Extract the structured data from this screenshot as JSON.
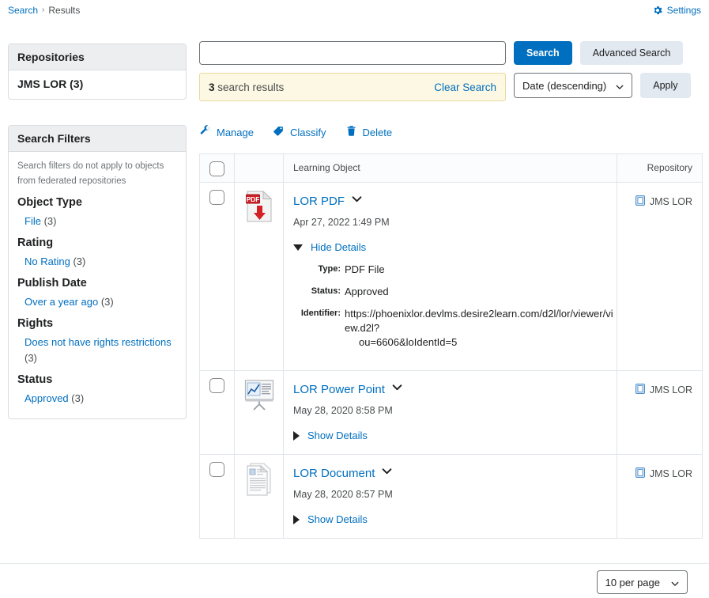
{
  "breadcrumb": {
    "root": "Search",
    "separator": "›",
    "current": "Results"
  },
  "settings": {
    "label": "Settings",
    "icon": "gear-icon",
    "color": "#006fbf"
  },
  "sidebar": {
    "repositories": {
      "title": "Repositories",
      "items": [
        {
          "label": "JMS LOR (3)"
        }
      ]
    },
    "search_filters": {
      "title": "Search Filters",
      "note": "Search filters do not apply to objects from federated repositories",
      "groups": [
        {
          "title": "Object Type",
          "options": [
            {
              "link": "File",
              "count": "(3)"
            }
          ]
        },
        {
          "title": "Rating",
          "options": [
            {
              "link": "No Rating",
              "count": "(3)"
            }
          ]
        },
        {
          "title": "Publish Date",
          "options": [
            {
              "link": "Over a year ago",
              "count": "(3)"
            }
          ]
        },
        {
          "title": "Rights",
          "options": [
            {
              "link": "Does not have rights restrictions",
              "count": "(3)"
            }
          ]
        },
        {
          "title": "Status",
          "options": [
            {
              "link": "Approved",
              "count": "(3)"
            }
          ]
        }
      ]
    }
  },
  "search": {
    "value": "",
    "placeholder": "",
    "search_button": "Search",
    "advanced_button": "Advanced Search"
  },
  "results_bar": {
    "count": "3",
    "count_suffix": " search results",
    "clear_label": "Clear Search",
    "sort_value": "Date (descending)",
    "apply_label": "Apply"
  },
  "actions": [
    {
      "label": "Manage",
      "icon": "wrench-icon"
    },
    {
      "label": "Classify",
      "icon": "tag-icon"
    },
    {
      "label": "Delete",
      "icon": "trash-icon"
    }
  ],
  "table": {
    "headers": {
      "learning_object": "Learning Object",
      "repository": "Repository"
    },
    "rows": [
      {
        "title": "LOR PDF",
        "icon": "pdf-file-icon",
        "date": "Apr 27, 2022 1:49 PM",
        "details_toggle": "Hide Details",
        "expanded": true,
        "details": [
          {
            "key": "Type:",
            "value": "PDF File"
          },
          {
            "key": "Status:",
            "value": "Approved"
          },
          {
            "key": "Identifier:",
            "value": "https://phoenixlor.devlms.desire2learn.com/d2l/lor/viewer/view.d2l?",
            "value2": "ou=6606&loIdentId=5"
          }
        ],
        "repository": "JMS LOR"
      },
      {
        "title": "LOR Power Point",
        "icon": "powerpoint-file-icon",
        "date": "May 28, 2020 8:58 PM",
        "details_toggle": "Show Details",
        "expanded": false,
        "details": [],
        "repository": "JMS LOR"
      },
      {
        "title": "LOR Document",
        "icon": "document-file-icon",
        "date": "May 28, 2020 8:57 PM",
        "details_toggle": "Show Details",
        "expanded": false,
        "details": [],
        "repository": "JMS LOR"
      }
    ]
  },
  "footer": {
    "per_page": "10 per page"
  },
  "colors": {
    "link": "#006fbf",
    "primary_button": "#006fbf",
    "results_bg": "#fdf8e3"
  }
}
